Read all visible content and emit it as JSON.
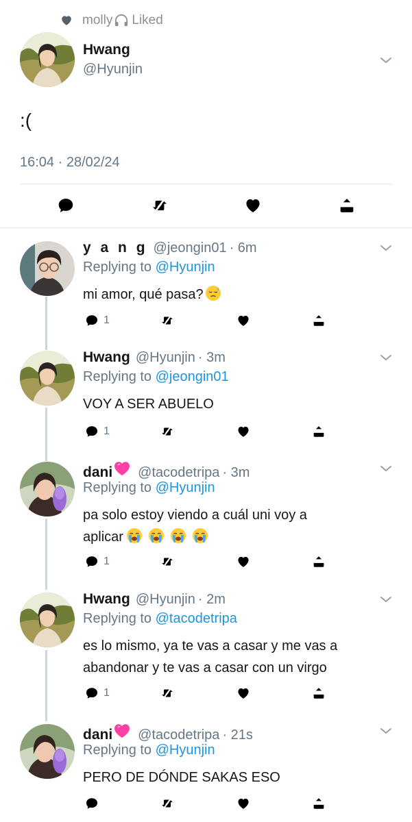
{
  "context": {
    "user": "molly",
    "action": "Liked",
    "heart_icon": "heart-icon",
    "emoji_icon": "headphone-emoji-icon"
  },
  "tweet": {
    "name": "Hwang",
    "handle": "@Hyunjin",
    "text": ":(",
    "timestamp": "16:04 · 28/02/24",
    "actions": [
      "reply-icon",
      "retweet-icon",
      "like-icon",
      "share-icon"
    ]
  },
  "replies": [
    {
      "name": "y a n g",
      "handle": "@jeongin01",
      "time": "· 6m",
      "replying_label": "Replying to",
      "replying_to": "@Hyunjin",
      "text": "mi amor, qué pasa?",
      "emoji": [
        "sad-sweat-emoji"
      ],
      "reply_count": "1"
    },
    {
      "name": "Hwang",
      "handle": "@Hyunjin",
      "time": "· 3m",
      "replying_label": "Replying to",
      "replying_to": "@jeongin01",
      "text": "VOY A SER ABUELO",
      "reply_count": "1"
    },
    {
      "name": "dani",
      "handle": "@tacodetripa",
      "time": "· 3m",
      "replying_label": "Replying to",
      "replying_to": "@Hyunjin",
      "text_line1": "pa solo estoy viendo a cuál uni voy a",
      "text_line2": "aplicar",
      "emoji": [
        "crying-face",
        "crying-face",
        "crying-face",
        "crying-face"
      ],
      "reply_count": "1"
    },
    {
      "name": "Hwang",
      "handle": "@Hyunjin",
      "time": "· 2m",
      "replying_label": "Replying to",
      "replying_to": "@tacodetripa",
      "text_line1": "es lo mismo, ya te vas a casar y me vas a",
      "text_line2": "abandonar y te vas a casar con un virgo",
      "reply_count": "1"
    },
    {
      "name": "dani",
      "handle": "@tacodetripa",
      "time": "· 21s",
      "replying_label": "Replying to",
      "replying_to": "@Hyunjin",
      "text": "PERO DE DÓNDE SAKAS ESO",
      "reply_count": ""
    }
  ],
  "colors": {
    "link": "#1b95e0",
    "muted": "#657786",
    "text": "#14171a",
    "divider": "#e1e8ed",
    "thread_line": "#ccd6dd"
  }
}
